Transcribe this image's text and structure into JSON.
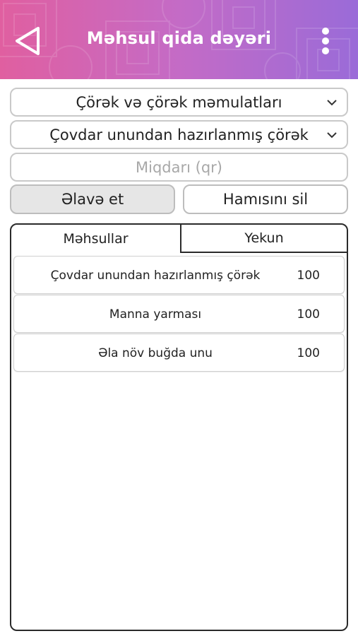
{
  "header": {
    "title": "Məhsul qida dəyəri",
    "back_icon": "back-triangle-icon",
    "menu_icon": "more-vertical-icon"
  },
  "form": {
    "category_select": "Çörək və çörək məmulatları",
    "product_select": "Çovdar unundan hazırlanmış çörək",
    "amount_placeholder": "Miqdarı (qr)",
    "add_label": "Əlavə et",
    "clear_all_label": "Hamısını sil"
  },
  "tabs": {
    "products": "Məhsullar",
    "total": "Yekun"
  },
  "items": [
    {
      "name": "Çovdar unundan hazırlanmış çörək",
      "qty": "100"
    },
    {
      "name": "Manna yarması",
      "qty": "100"
    },
    {
      "name": "Əla növ buğda unu",
      "qty": "100"
    }
  ],
  "colors": {
    "header_gradient_start": "#e05fa0",
    "header_gradient_end": "#9a6bd8"
  }
}
